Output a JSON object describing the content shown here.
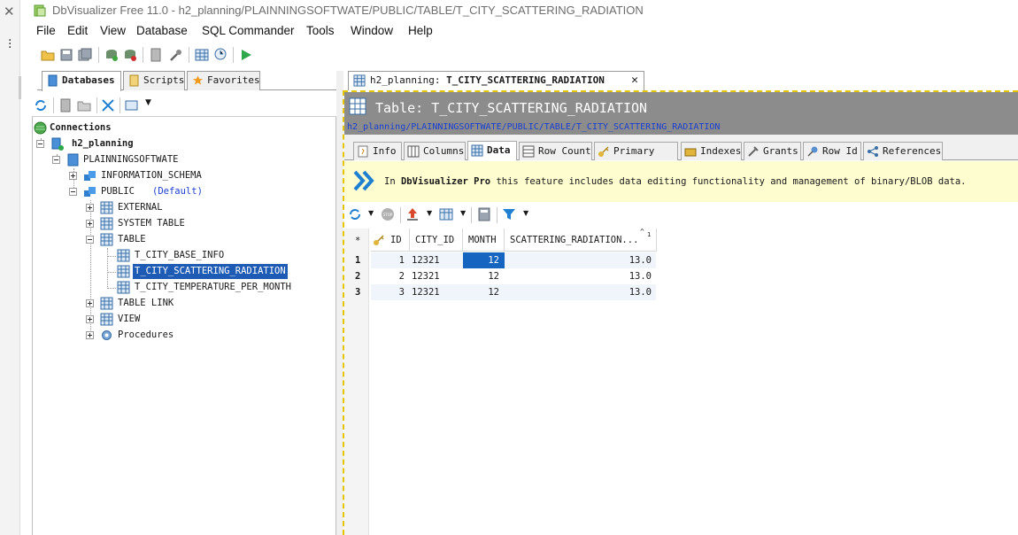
{
  "window": {
    "title": "DbVisualizer Free 11.0 - h2_planning/PLAINNINGSOFTWATE/PUBLIC/TABLE/T_CITY_SCATTERING_RADIATION"
  },
  "menu": [
    "File",
    "Edit",
    "View",
    "Database",
    "SQL Commander",
    "Tools",
    "Window",
    "Help"
  ],
  "left_panel": {
    "tabs": [
      "Databases",
      "Scripts",
      "Favorites"
    ],
    "active_tab": "Databases",
    "tree": {
      "connections_label": "Connections",
      "connection": "h2_planning",
      "catalog": "PLAINNINGSOFTWATE",
      "schema_info": "INFORMATION_SCHEMA",
      "schema_public": "PUBLIC",
      "schema_public_note": "(Default)",
      "external": "EXTERNAL",
      "system_table": "SYSTEM TABLE",
      "table": "TABLE",
      "tables": [
        "T_CITY_BASE_INFO",
        "T_CITY_SCATTERING_RADIATION",
        "T_CITY_TEMPERATURE_PER_MONTH"
      ],
      "selected_table": "T_CITY_SCATTERING_RADIATION",
      "table_link": "TABLE LINK",
      "view": "VIEW",
      "procedures": "Procedures"
    }
  },
  "editor": {
    "tab_prefix": "h2_planning:",
    "tab_name": "T_CITY_SCATTERING_RADIATION",
    "close_glyph": "✕",
    "header_title": "Table: T_CITY_SCATTERING_RADIATION",
    "path": "h2_planning/PLAINNINGSOFTWATE/PUBLIC/TABLE/T_CITY_SCATTERING_RADIATION",
    "subtabs": [
      "Info",
      "Columns",
      "Data",
      "Row Count",
      "Primary Key",
      "Indexes",
      "Grants",
      "Row Id",
      "References"
    ],
    "active_subtab": "Data",
    "promo": {
      "prefix": "In",
      "product": "DbVisualizer Pro",
      "suffix": "this feature includes data editing functionality and management of binary/BLOB data."
    },
    "grid": {
      "corner": "*",
      "columns": [
        "ID",
        "CITY_ID",
        "MONTH",
        "SCATTERING_RADIATION..."
      ],
      "sort_indicator": "1",
      "rows": [
        {
          "num": "1",
          "ID": "1",
          "CITY_ID": "12321",
          "MONTH": "12",
          "SCATTERING_RADIATION": "13.0"
        },
        {
          "num": "2",
          "ID": "2",
          "CITY_ID": "12321",
          "MONTH": "12",
          "SCATTERING_RADIATION": "13.0"
        },
        {
          "num": "3",
          "ID": "3",
          "CITY_ID": "12321",
          "MONTH": "12",
          "SCATTERING_RADIATION": "13.0"
        }
      ],
      "selected_cell": {
        "row": 0,
        "column": "MONTH"
      }
    }
  },
  "colors": {
    "accent_blue": "#1e5bb5",
    "header_gray": "#8c8c8c",
    "promo_yellow": "#fdfdd0",
    "highlight_dashed": "#e5c400"
  }
}
